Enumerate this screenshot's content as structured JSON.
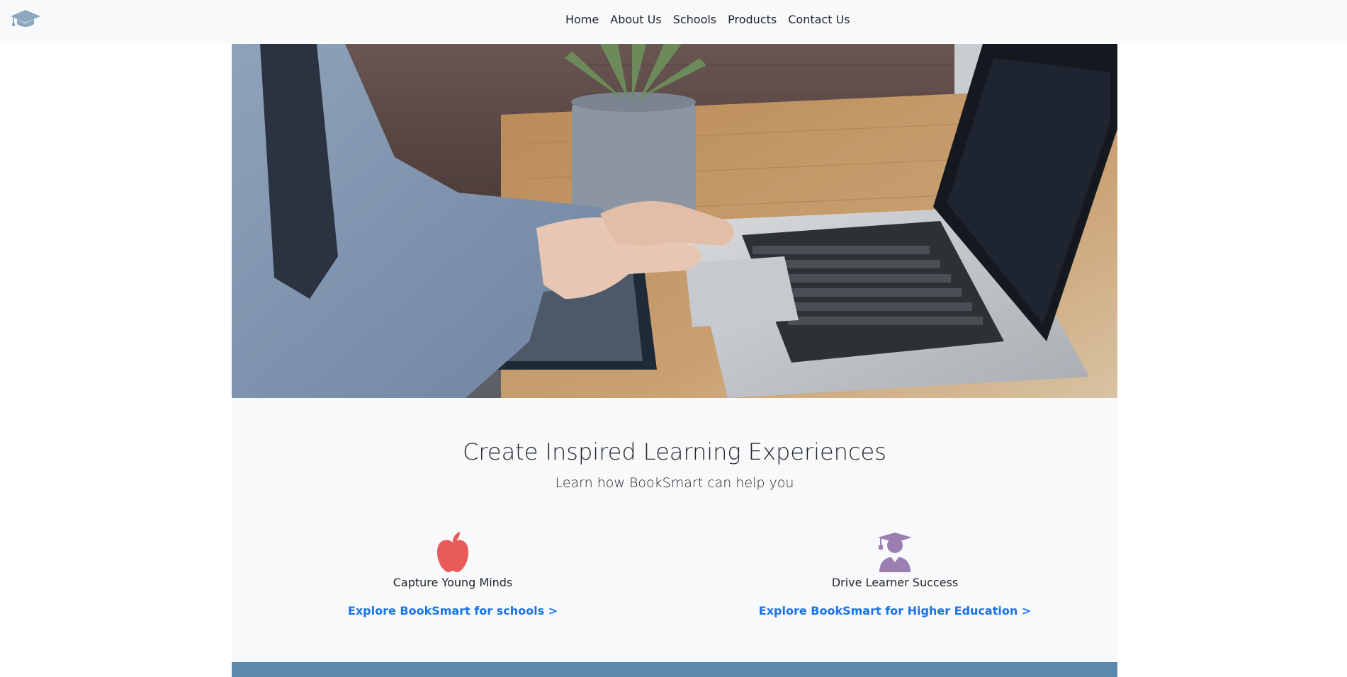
{
  "nav": {
    "brand_icon": "graduation-cap-icon",
    "brand_color": "#8fa8c2",
    "links": [
      {
        "label": "Home"
      },
      {
        "label": "About Us"
      },
      {
        "label": "Schools"
      },
      {
        "label": "Products"
      },
      {
        "label": "Contact Us"
      }
    ]
  },
  "hero": {
    "image_subject": "person typing on laptop with tablet and stylus on wooden desk"
  },
  "intro": {
    "heading": "Create Inspired Learning Experiences",
    "subheading": "Learn how BookSmart can help you"
  },
  "features": [
    {
      "icon": "apple-icon",
      "icon_color": "#e95b5b",
      "title": "Capture Young Minds",
      "link": "Explore BookSmart for schools >"
    },
    {
      "icon": "graduate-user-icon",
      "icon_color": "#9b7fb3",
      "title": "Drive Learner Success",
      "link": "Explore BookSmart for Higher Education >"
    }
  ],
  "colors": {
    "link": "#1a73e8",
    "footer_bar": "#5a89ac",
    "section_bg": "#f8f9fa"
  }
}
